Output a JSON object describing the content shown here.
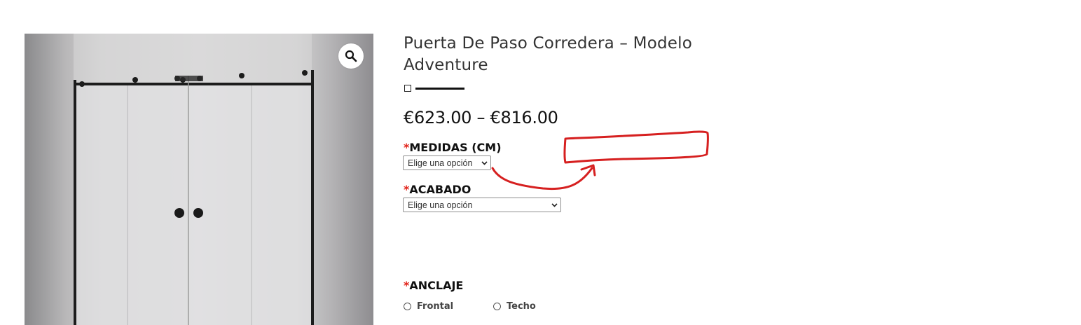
{
  "product": {
    "title": "Puerta De Paso Corredera – Modelo Adventure",
    "price": "€623.00 – €816.00",
    "image_alt_icon": "sliding-glass-door-image"
  },
  "zoom": {
    "icon": "magnifier-icon"
  },
  "fields": {
    "medidas": {
      "required_mark": "*",
      "label": "MEDIDAS (CM)",
      "select_value": "Elige una opción"
    },
    "acabado": {
      "required_mark": "*",
      "label": "ACABADO",
      "select_value": "Elige una opción"
    },
    "anclaje": {
      "required_mark": "*",
      "label": "ANCLAJE",
      "options": [
        {
          "label": "Frontal",
          "selected": false
        },
        {
          "label": "Techo",
          "selected": false
        }
      ]
    }
  },
  "colors": {
    "required": "#e2231a",
    "annotation": "#d62020"
  }
}
